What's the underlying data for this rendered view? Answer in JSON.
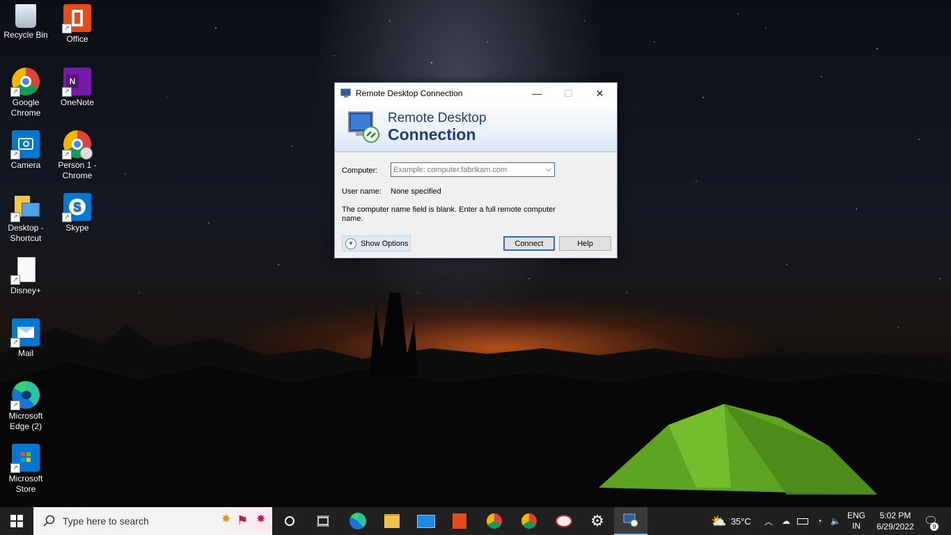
{
  "desktop": {
    "icons": [
      {
        "label": "Recycle Bin",
        "icon": "recycle-bin-icon"
      },
      {
        "label": "Office",
        "icon": "office-icon"
      },
      {
        "label": "Google Chrome",
        "icon": "chrome-icon"
      },
      {
        "label": "OneNote",
        "icon": "onenote-icon"
      },
      {
        "label": "Camera",
        "icon": "camera-icon"
      },
      {
        "label": "Person 1 - Chrome",
        "icon": "chrome-profile-icon"
      },
      {
        "label": "Desktop - Shortcut",
        "icon": "desktop-shortcut-icon"
      },
      {
        "label": "Skype",
        "icon": "skype-icon"
      },
      {
        "label": "Disney+",
        "icon": "file-icon"
      },
      {
        "label": "Mail",
        "icon": "mail-icon"
      },
      {
        "label": "Microsoft Edge (2)",
        "icon": "edge-icon"
      },
      {
        "label": "Microsoft Store",
        "icon": "store-icon"
      }
    ]
  },
  "dialog": {
    "title": "Remote Desktop Connection",
    "banner_line1": "Remote Desktop",
    "banner_line2": "Connection",
    "computer_label": "Computer:",
    "computer_placeholder": "Example: computer.fabrikam.com",
    "computer_value": "",
    "username_label": "User name:",
    "username_value": "None specified",
    "message": "The computer name field is blank. Enter a full remote computer name.",
    "show_options": "Show Options",
    "connect": "Connect",
    "help": "Help"
  },
  "taskbar": {
    "search_placeholder": "Type here to search",
    "weather": "35°C",
    "language_line1": "ENG",
    "language_line2": "IN",
    "time": "5:02 PM",
    "date": "6/29/2022",
    "notification_count": "9"
  },
  "colors": {
    "taskbar": "#202020",
    "accent": "#1f6fc9",
    "banner_text": "#1f3f73"
  }
}
